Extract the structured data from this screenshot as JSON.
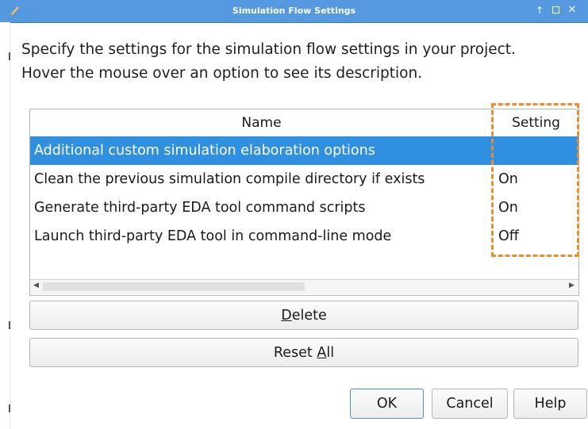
{
  "window": {
    "title": "Simulation Flow Settings",
    "controls": {
      "up_glyph": "↑",
      "close_glyph": "✕"
    }
  },
  "description": {
    "line1": "Specify the settings for the simulation flow settings in your project.",
    "line2": "Hover the mouse over an option to see its description."
  },
  "table": {
    "columns": {
      "name": "Name",
      "setting": "Setting"
    },
    "rows": [
      {
        "name": "Additional custom simulation elaboration options",
        "setting": "",
        "selected": true
      },
      {
        "name": "Clean the previous simulation compile directory if exists",
        "setting": "On",
        "selected": false
      },
      {
        "name": "Generate third-party EDA tool command scripts",
        "setting": "On",
        "selected": false
      },
      {
        "name": "Launch third-party EDA tool in command-line mode",
        "setting": "Off",
        "selected": false
      }
    ]
  },
  "buttons": {
    "delete": {
      "pre": "",
      "mnemonic": "D",
      "post": "elete"
    },
    "reset_all": {
      "pre": "Reset ",
      "mnemonic": "A",
      "post": "ll"
    },
    "ok": "OK",
    "cancel": "Cancel",
    "help": "Help"
  },
  "colors": {
    "titlebar": "#5599e0",
    "selection": "#2f8fe0",
    "highlight_box": "#f08c2a"
  }
}
